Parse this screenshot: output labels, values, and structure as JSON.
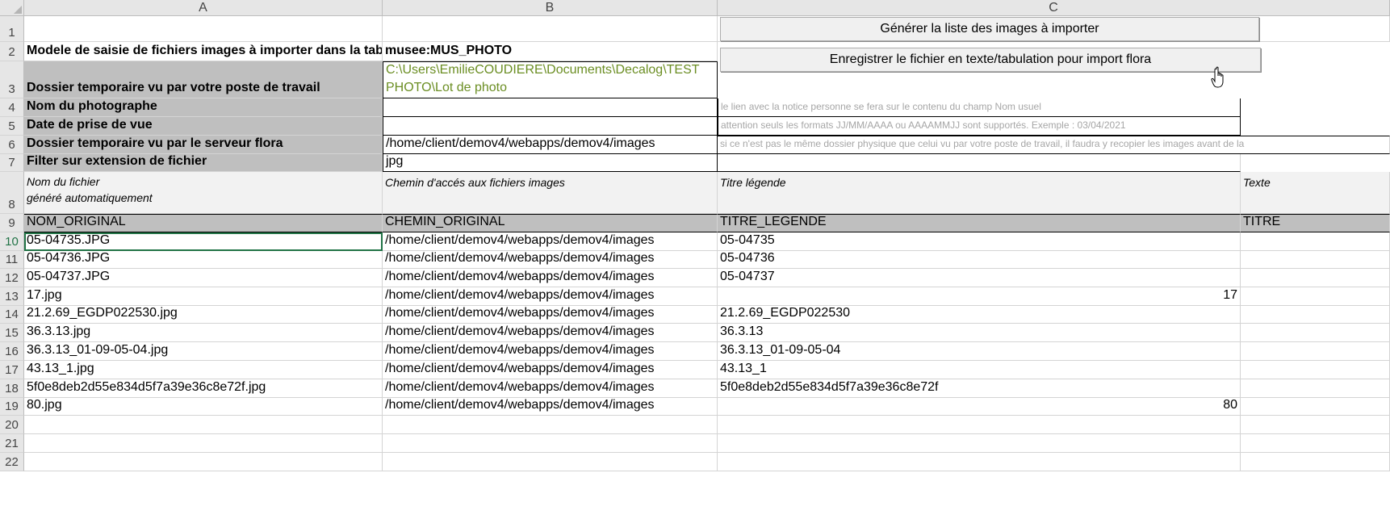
{
  "columns": [
    "A",
    "B",
    "C"
  ],
  "rows": [
    "1",
    "2",
    "3",
    "4",
    "5",
    "6",
    "7",
    "8",
    "9",
    "10",
    "11",
    "12",
    "13",
    "14",
    "15",
    "16",
    "17",
    "18",
    "19",
    "20",
    "21",
    "22"
  ],
  "header_block": {
    "r2_a": "Modele de saisie de fichiers images à importer dans la table",
    "r2_b": "musee:MUS_PHOTO",
    "r3_a": "Dossier temporaire vu par votre poste de travail",
    "r3_b_line1": "C:\\Users\\EmilieCOUDIERE\\Documents\\Decalog\\TEST",
    "r3_b_line2": "PHOTO\\Lot de photo",
    "r4_a": "Nom du photographe",
    "r4_c": "le lien avec la notice personne se fera sur le contenu du champ Nom usuel",
    "r5_a": "Date de prise de vue",
    "r5_c": "attention seuls les formats JJ/MM/AAAA ou AAAAMMJJ sont supportés. Exemple : 03/04/2021",
    "r6_a": "Dossier temporaire vu par le serveur flora",
    "r6_b": "/home/client/demov4/webapps/demov4/images",
    "r6_c": "si ce n'est pas le même dossier physique que celui vu par votre poste de travail, il faudra y recopier les images avant de la",
    "r7_a": "Filter sur extension de fichier",
    "r7_b": "jpg"
  },
  "descriptions": {
    "a_line1": "Nom du fichier",
    "a_line2": "généré automatiquement",
    "b": "Chemin d'accés aux fichiers  images",
    "c": "Titre légende",
    "d": "Texte"
  },
  "field_names": {
    "a": "NOM_ORIGINAL",
    "b": "CHEMIN_ORIGINAL",
    "c": "TITRE_LEGENDE",
    "d": "TITRE"
  },
  "buttons": {
    "generate": "Générer la liste des images à importer",
    "save": "Enregistrer le fichier en texte/tabulation pour import flora"
  },
  "data_rows": [
    {
      "name": "05-04735.JPG",
      "path": "/home/client/demov4/webapps/demov4/images",
      "title": "05-04735",
      "align": "left"
    },
    {
      "name": "05-04736.JPG",
      "path": "/home/client/demov4/webapps/demov4/images",
      "title": "05-04736",
      "align": "left"
    },
    {
      "name": "05-04737.JPG",
      "path": "/home/client/demov4/webapps/demov4/images",
      "title": "05-04737",
      "align": "left"
    },
    {
      "name": "17.jpg",
      "path": "/home/client/demov4/webapps/demov4/images",
      "title": "17",
      "align": "right"
    },
    {
      "name": "21.2.69_EGDP022530.jpg",
      "path": "/home/client/demov4/webapps/demov4/images",
      "title": "21.2.69_EGDP022530",
      "align": "left"
    },
    {
      "name": "36.3.13.jpg",
      "path": "/home/client/demov4/webapps/demov4/images",
      "title": "36.3.13",
      "align": "left"
    },
    {
      "name": "36.3.13_01-09-05-04.jpg",
      "path": "/home/client/demov4/webapps/demov4/images",
      "title": "36.3.13_01-09-05-04",
      "align": "left"
    },
    {
      "name": "43.13_1.jpg",
      "path": "/home/client/demov4/webapps/demov4/images",
      "title": "43.13_1",
      "align": "left"
    },
    {
      "name": "5f0e8deb2d55e834d5f7a39e36c8e72f.jpg",
      "path": "/home/client/demov4/webapps/demov4/images",
      "title": "5f0e8deb2d55e834d5f7a39e36c8e72f",
      "align": "left"
    },
    {
      "name": "80.jpg",
      "path": "/home/client/demov4/webapps/demov4/images",
      "title": "80",
      "align": "right"
    }
  ],
  "colors": {
    "header_gray": "#bfbfbf",
    "path_green": "#6b8e23",
    "note_gray": "#a6a6a6",
    "active_row": "#217346"
  }
}
